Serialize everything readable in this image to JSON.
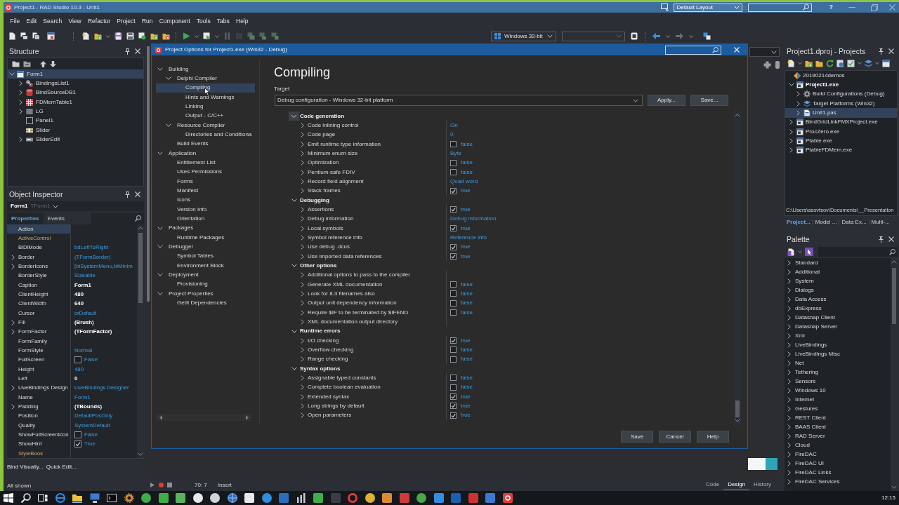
{
  "window": {
    "title": "Project1 - RAD Studio 10.3 - Unit1",
    "layout": "Default Layout",
    "help": "?"
  },
  "menu": [
    "File",
    "Edit",
    "Search",
    "View",
    "Refactor",
    "Project",
    "Run",
    "Component",
    "Tools",
    "Tabs",
    "Help"
  ],
  "toolbar": {
    "platform": "Windows 32-bit"
  },
  "structure": {
    "title": "Structure",
    "tree": [
      {
        "label": "Form1",
        "kind": "form",
        "expanded": true,
        "selected": true,
        "children": [
          {
            "label": "BindingsList1",
            "kind": "bindings",
            "expanded": false,
            "selected": false
          },
          {
            "label": "BindSourceDB1",
            "kind": "bindsource",
            "expanded": false,
            "selected": false
          },
          {
            "label": "FDMemTable1",
            "kind": "table",
            "expanded": false,
            "selected": false
          },
          {
            "label": "LG",
            "kind": "grid",
            "expanded": false,
            "selected": false
          },
          {
            "label": "Panel1",
            "kind": "panel",
            "selected": false
          },
          {
            "label": "Slider",
            "kind": "slider",
            "selected": false
          },
          {
            "label": "SliderEdit",
            "kind": "edit",
            "expanded": false,
            "selected": false
          }
        ]
      }
    ]
  },
  "object_inspector": {
    "title": "Object Inspector",
    "object": {
      "name": "Form1",
      "type": "TForm1"
    },
    "tabs": [
      {
        "label": "Properties",
        "selected": true
      },
      {
        "label": "Events",
        "selected": false
      }
    ],
    "properties": [
      {
        "name": "Action",
        "reference": false,
        "selected": true,
        "kind": "text"
      },
      {
        "name": "ActiveControl",
        "reference": true,
        "selected": false,
        "kind": "text"
      },
      {
        "name": "BiDiMode",
        "reference": false,
        "selected": false,
        "kind": "text",
        "value": "bdLeftToRight",
        "modified": false
      },
      {
        "name": "Border",
        "expanded": false,
        "reference": false,
        "selected": false,
        "kind": "text",
        "value": "(TFormBorder)",
        "modified": false
      },
      {
        "name": "BorderIcons",
        "expanded": false,
        "reference": false,
        "selected": false,
        "kind": "text",
        "value": "[biSystemMenu,biMinim",
        "modified": false
      },
      {
        "name": "BorderStyle",
        "reference": false,
        "selected": false,
        "kind": "text",
        "value": "Sizeable",
        "modified": false
      },
      {
        "name": "Caption",
        "reference": false,
        "selected": false,
        "kind": "text",
        "value": "Form1",
        "modified": true
      },
      {
        "name": "ClientHeight",
        "reference": false,
        "selected": false,
        "kind": "text",
        "value": "480",
        "modified": true
      },
      {
        "name": "ClientWidth",
        "reference": false,
        "selected": false,
        "kind": "text",
        "value": "640",
        "modified": true
      },
      {
        "name": "Cursor",
        "reference": false,
        "selected": false,
        "kind": "text",
        "value": "crDefault",
        "modified": false
      },
      {
        "name": "Fill",
        "expanded": false,
        "reference": false,
        "selected": false,
        "kind": "text",
        "value": "(Brush)",
        "modified": true
      },
      {
        "name": "FormFactor",
        "expanded": false,
        "reference": false,
        "selected": false,
        "kind": "text",
        "value": "(TFormFactor)",
        "modified": true
      },
      {
        "name": "FormFamily",
        "reference": false,
        "selected": false,
        "kind": "text"
      },
      {
        "name": "FormStyle",
        "reference": false,
        "selected": false,
        "kind": "text",
        "value": "Normal",
        "modified": false
      },
      {
        "name": "FullScreen",
        "reference": false,
        "selected": false,
        "kind": "check",
        "checked": false,
        "value": "False",
        "modified": false
      },
      {
        "name": "Height",
        "reference": false,
        "selected": false,
        "kind": "text",
        "value": "480",
        "modified": false
      },
      {
        "name": "Left",
        "reference": false,
        "selected": false,
        "kind": "text",
        "value": "0",
        "modified": true
      },
      {
        "name": "LiveBindings Design",
        "expanded": false,
        "reference": false,
        "selected": false,
        "kind": "text",
        "value": "LiveBindings Designer",
        "modified": false
      },
      {
        "name": "Name",
        "reference": false,
        "selected": false,
        "kind": "text",
        "value": "Form1",
        "modified": false
      },
      {
        "name": "Padding",
        "expanded": false,
        "reference": false,
        "selected": false,
        "kind": "text",
        "value": "(TBounds)",
        "modified": true
      },
      {
        "name": "Position",
        "reference": false,
        "selected": false,
        "kind": "text",
        "value": "DefaultPosOnly",
        "modified": false
      },
      {
        "name": "Quality",
        "reference": false,
        "selected": false,
        "kind": "text",
        "value": "SystemDefault",
        "modified": false
      },
      {
        "name": "ShowFullScreenIcon",
        "reference": false,
        "selected": false,
        "kind": "check",
        "checked": false,
        "value": "False",
        "modified": false
      },
      {
        "name": "ShowHint",
        "reference": false,
        "selected": false,
        "kind": "check",
        "checked": true,
        "value": "True",
        "modified": false
      },
      {
        "name": "StyleBook",
        "reference": true,
        "selected": false,
        "kind": "text"
      }
    ],
    "links": [
      "Bind Visually...",
      "Quick Edit..."
    ],
    "status": "All shown"
  },
  "dialog": {
    "title": "Project Options for Project1.exe (Win32 - Debug)",
    "tree": [
      {
        "label": "Building",
        "expanded": true,
        "selected": false,
        "children": [
          {
            "label": "Delphi Compiler",
            "expanded": true,
            "selected": false,
            "children": [
              {
                "label": "Compiling",
                "selected": true
              },
              {
                "label": "Hints and Warnings",
                "selected": false
              },
              {
                "label": "Linking",
                "selected": false
              },
              {
                "label": "Output - C/C++",
                "selected": false
              }
            ]
          },
          {
            "label": "Resource Compiler",
            "expanded": true,
            "selected": false,
            "children": [
              {
                "label": "Directories and Conditiona",
                "selected": false
              }
            ]
          },
          {
            "label": "Build Events",
            "selected": false
          }
        ]
      },
      {
        "label": "Application",
        "expanded": true,
        "selected": false,
        "children": [
          {
            "label": "Entitlement List",
            "selected": false
          },
          {
            "label": "Uses Permissions",
            "selected": false
          },
          {
            "label": "Forms",
            "selected": false
          },
          {
            "label": "Manifest",
            "selected": false
          },
          {
            "label": "Icons",
            "selected": false
          },
          {
            "label": "Version Info",
            "selected": false
          },
          {
            "label": "Orientation",
            "selected": false
          }
        ]
      },
      {
        "label": "Packages",
        "expanded": true,
        "selected": false,
        "children": [
          {
            "label": "Runtime Packages",
            "selected": false
          }
        ]
      },
      {
        "label": "Debugger",
        "expanded": true,
        "selected": false,
        "children": [
          {
            "label": "Symbol Tables",
            "selected": false
          },
          {
            "label": "Environment Block",
            "selected": false
          }
        ]
      },
      {
        "label": "Deployment",
        "expanded": true,
        "selected": false,
        "children": [
          {
            "label": "Provisioning",
            "selected": false
          }
        ]
      },
      {
        "label": "Project Properties",
        "expanded": true,
        "selected": false,
        "children": [
          {
            "label": "GetIt Dependencies",
            "selected": false
          }
        ]
      }
    ],
    "heading": "Compiling",
    "target_label": "Target",
    "target": "Debug configuration - Windows 32-bit platform",
    "target_buttons": [
      "Apply...",
      "Save..."
    ],
    "categories": [
      {
        "name": "Code generation",
        "expanded": true,
        "selected": true,
        "options": [
          {
            "name": "Code inlining control",
            "kind": "text",
            "value": "On"
          },
          {
            "name": "Code page",
            "kind": "text",
            "value": "0"
          },
          {
            "name": "Emit runtime type information",
            "kind": "check",
            "checked": false,
            "value": "false"
          },
          {
            "name": "Minimum enum size",
            "kind": "text",
            "value": "Byte"
          },
          {
            "name": "Optimization",
            "kind": "check",
            "checked": false,
            "value": "false"
          },
          {
            "name": "Pentium-safe FDIV",
            "kind": "check",
            "checked": false,
            "value": "false"
          },
          {
            "name": "Record field alignment",
            "kind": "text",
            "value": "Quad word"
          },
          {
            "name": "Stack frames",
            "kind": "check",
            "checked": true,
            "value": "true"
          }
        ]
      },
      {
        "name": "Debugging",
        "expanded": true,
        "selected": false,
        "options": [
          {
            "name": "Assertions",
            "kind": "check",
            "checked": true,
            "value": "true"
          },
          {
            "name": "Debug information",
            "kind": "text",
            "value": "Debug information"
          },
          {
            "name": "Local symbols",
            "kind": "check",
            "checked": true,
            "value": "true"
          },
          {
            "name": "Symbol reference info",
            "kind": "text",
            "value": "Reference info"
          },
          {
            "name": "Use debug .dcus",
            "kind": "check",
            "checked": true,
            "value": "true"
          },
          {
            "name": "Use imported data references",
            "kind": "check",
            "checked": true,
            "value": "true"
          }
        ]
      },
      {
        "name": "Other options",
        "expanded": true,
        "selected": false,
        "options": [
          {
            "name": "Additional options to pass to the compiler",
            "kind": "text"
          },
          {
            "name": "Generate XML documentation",
            "kind": "check",
            "checked": false,
            "value": "false"
          },
          {
            "name": "Look for 8.3 filenames also",
            "kind": "check",
            "checked": false,
            "value": "false"
          },
          {
            "name": "Output unit dependency information",
            "kind": "check",
            "checked": false,
            "value": "false"
          },
          {
            "name": "Require $IF to be terminated by $IFEND",
            "kind": "check",
            "checked": false,
            "value": "false"
          },
          {
            "name": "XML documentation output directory",
            "kind": "text"
          }
        ]
      },
      {
        "name": "Runtime errors",
        "expanded": true,
        "selected": false,
        "options": [
          {
            "name": "I/O checking",
            "kind": "check",
            "checked": true,
            "value": "true"
          },
          {
            "name": "Overflow checking",
            "kind": "check",
            "checked": false,
            "value": "false"
          },
          {
            "name": "Range checking",
            "kind": "check",
            "checked": false,
            "value": "false"
          }
        ]
      },
      {
        "name": "Syntax options",
        "expanded": true,
        "selected": false,
        "options": [
          {
            "name": "Assignable typed constants",
            "kind": "check",
            "checked": false,
            "value": "false"
          },
          {
            "name": "Complete boolean evaluation",
            "kind": "check",
            "checked": false,
            "value": "false"
          },
          {
            "name": "Extended syntax",
            "kind": "check",
            "checked": true,
            "value": "true"
          },
          {
            "name": "Long strings by default",
            "kind": "check",
            "checked": true,
            "value": "true"
          },
          {
            "name": "Open parameters",
            "kind": "check",
            "checked": true,
            "value": "true"
          }
        ]
      }
    ],
    "buttons": [
      "Save",
      "Cancel",
      "Help"
    ]
  },
  "status_bar": {
    "position": "70: 7",
    "mode": "Insert",
    "views": [
      {
        "label": "Code",
        "selected": false
      },
      {
        "label": "Design",
        "selected": true
      },
      {
        "label": "History",
        "selected": false
      }
    ]
  },
  "projects": {
    "title": "Project1.dproj - Projects",
    "tree": [
      {
        "label": "20190214demos",
        "kind": "group",
        "active": false,
        "selected": false,
        "children": [
          {
            "label": "Project1.exe",
            "kind": "exe",
            "expanded": true,
            "active": true,
            "selected": false,
            "children": [
              {
                "label": "Build Configurations (Debug)",
                "kind": "config",
                "expanded": false,
                "active": false,
                "selected": false
              },
              {
                "label": "Target Platforms (Win32)",
                "kind": "platforms",
                "expanded": false,
                "active": false,
                "selected": false
              },
              {
                "label": "Unit1.pas",
                "kind": "unit",
                "expanded": false,
                "active": false,
                "selected": true
              }
            ]
          },
          {
            "label": "BindGridLinkFMXProject.exe",
            "kind": "exe",
            "expanded": false,
            "active": false,
            "selected": false
          },
          {
            "label": "ProcZero.exe",
            "kind": "exe",
            "expanded": false,
            "active": false,
            "selected": false
          },
          {
            "label": "Ptable.exe",
            "kind": "exe",
            "expanded": false,
            "active": false,
            "selected": false
          },
          {
            "label": "PtableFDMem.exe",
            "kind": "exe",
            "expanded": false,
            "active": false,
            "selected": false
          }
        ]
      }
    ],
    "path": "C:\\Users\\asovtsov\\Documents\\__Presentation",
    "tabs": [
      {
        "label": "Project...",
        "selected": true
      },
      {
        "label": "Model ...",
        "selected": false
      },
      {
        "label": "Data Ex...",
        "selected": false
      },
      {
        "label": "Multi-...",
        "selected": false
      }
    ]
  },
  "palette": {
    "title": "Palette",
    "categories": [
      "Standard",
      "Additional",
      "System",
      "Dialogs",
      "Data Access",
      "dbExpress",
      "Datasnap Client",
      "Datasnap Server",
      "Xml",
      "LiveBindings",
      "LiveBindings Misc",
      "Net",
      "Tethering",
      "Sensors",
      "Windows 10",
      "Internet",
      "Gestures",
      "REST Client",
      "BAAS Client",
      "RAD Server",
      "Cloud",
      "FireDAC",
      "FireDAC UI",
      "FireDAC Links",
      "FireDAC Services"
    ]
  },
  "taskbar": {
    "time": "12:15"
  }
}
